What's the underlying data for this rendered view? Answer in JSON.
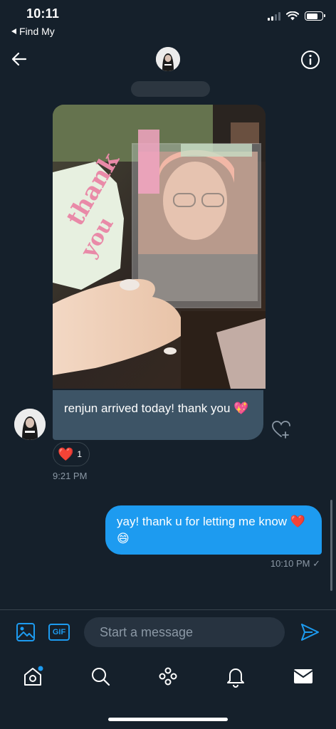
{
  "status_bar": {
    "time": "10:11",
    "back_app": "Find My",
    "battery_level": 0.75
  },
  "header": {
    "back_icon": "arrow-left-icon",
    "avatar_icon": "avatar",
    "info_icon": "info-icon"
  },
  "messages": {
    "incoming": {
      "text": "renjun arrived today! thank you 💖",
      "reaction_emoji": "❤️",
      "reaction_count": "1",
      "time": "9:21 PM"
    },
    "outgoing": {
      "text": "yay! thank u for letting me know ❤️😄",
      "time": "10:10 PM ✓"
    }
  },
  "composer": {
    "gif_label": "GIF",
    "placeholder": "Start a message"
  },
  "tabs": [
    "home-icon",
    "search-icon",
    "spaces-icon",
    "notifications-icon",
    "messages-icon"
  ],
  "colors": {
    "background": "#15202b",
    "accent": "#1d9bf0",
    "incoming_bubble": "#3d5466",
    "muted_text": "#8b98a5"
  }
}
